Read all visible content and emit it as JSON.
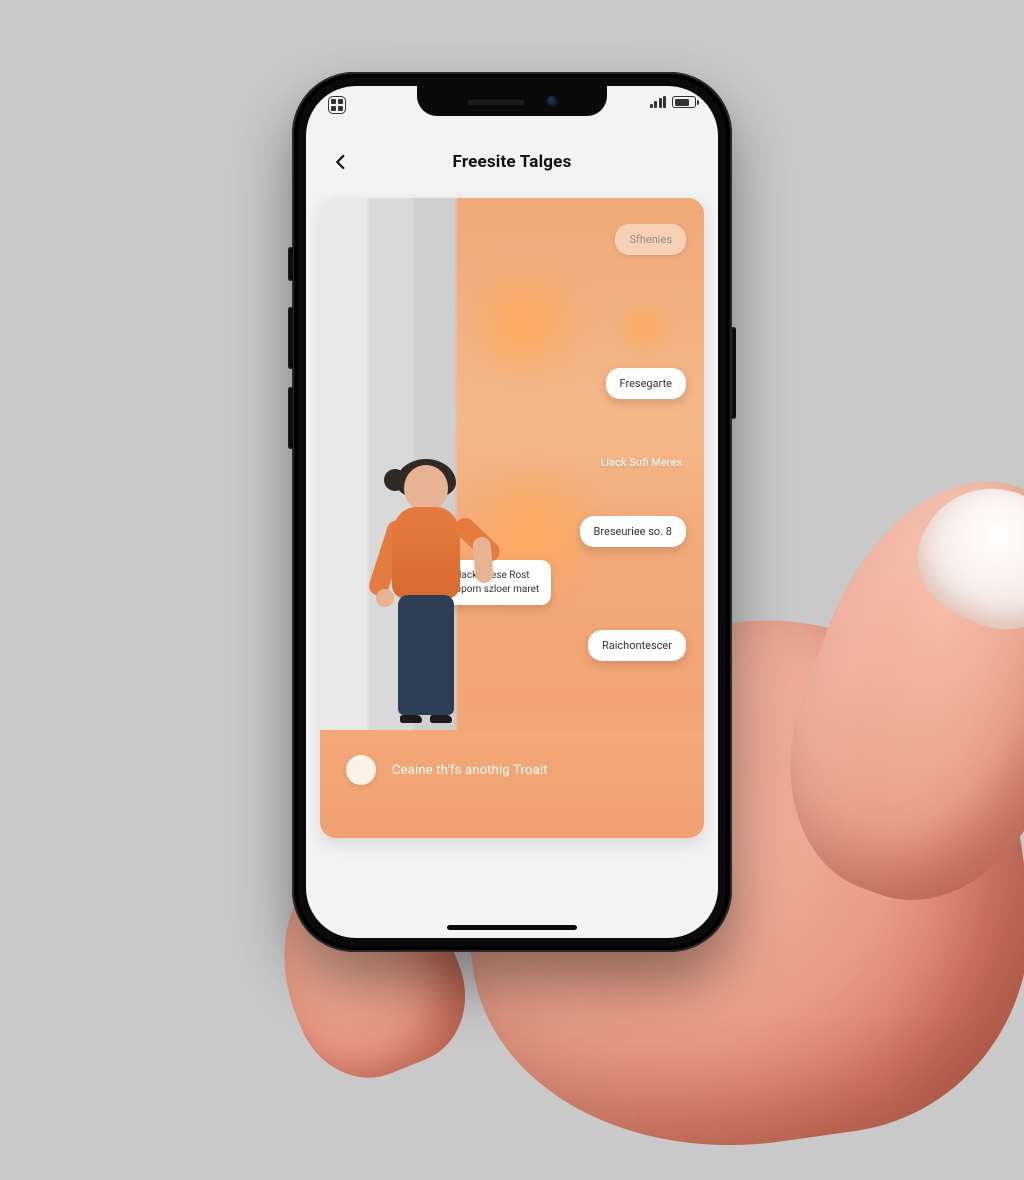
{
  "navbar": {
    "title": "Freesite Talges"
  },
  "chat": {
    "pill_top": "Sfhenies",
    "bubbles": {
      "b1": "Fresegarte",
      "label1": "Llack Sufi Meres",
      "b2": "Breseuriee so. 8",
      "b3_line1": "Dilack Allese Rost",
      "b3_line2": "Fopom szloer maret",
      "b4": "Raichontescer"
    }
  },
  "footer": {
    "prompt": "Ceaine th'fs anothig Troalt"
  },
  "colors": {
    "bg": "#c9c9c9",
    "accent": "#f2a475",
    "text": "#111111"
  }
}
